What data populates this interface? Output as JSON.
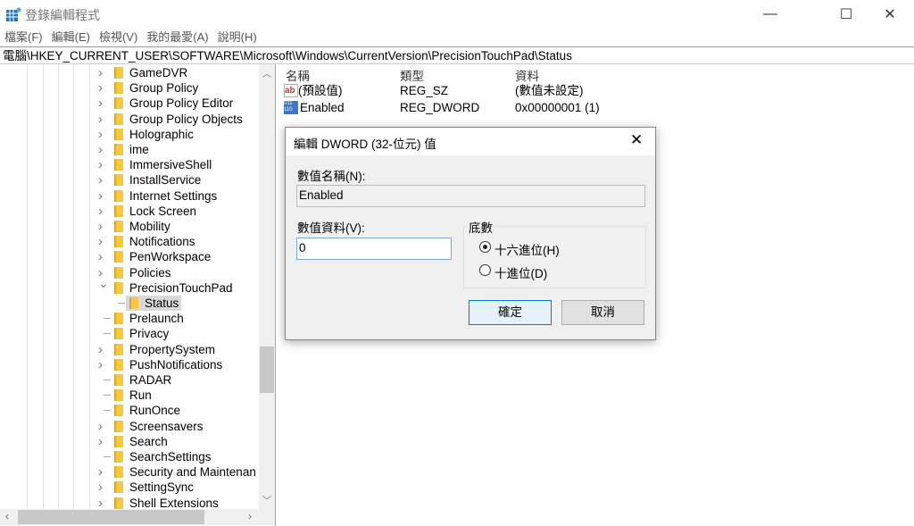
{
  "window": {
    "title": "登錄編輯程式",
    "minimize": "—",
    "maximize": "☐",
    "close": "✕"
  },
  "menu": [
    "檔案(F)",
    "編輯(E)",
    "檢視(V)",
    "我的最愛(A)",
    "說明(H)"
  ],
  "address": "電腦\\HKEY_CURRENT_USER\\SOFTWARE\\Microsoft\\Windows\\CurrentVersion\\PrecisionTouchPad\\Status",
  "tree": [
    {
      "label": "GameDVR",
      "exp": "collapsed"
    },
    {
      "label": "Group Policy",
      "exp": "collapsed"
    },
    {
      "label": "Group Policy Editor",
      "exp": "collapsed"
    },
    {
      "label": "Group Policy Objects",
      "exp": "collapsed"
    },
    {
      "label": "Holographic",
      "exp": "collapsed"
    },
    {
      "label": "ime",
      "exp": "collapsed"
    },
    {
      "label": "ImmersiveShell",
      "exp": "collapsed"
    },
    {
      "label": "InstallService",
      "exp": "collapsed"
    },
    {
      "label": "Internet Settings",
      "exp": "collapsed"
    },
    {
      "label": "Lock Screen",
      "exp": "collapsed"
    },
    {
      "label": "Mobility",
      "exp": "collapsed"
    },
    {
      "label": "Notifications",
      "exp": "collapsed"
    },
    {
      "label": "PenWorkspace",
      "exp": "collapsed"
    },
    {
      "label": "Policies",
      "exp": "collapsed"
    },
    {
      "label": "PrecisionTouchPad",
      "exp": "expanded"
    },
    {
      "label": "Status",
      "exp": "none",
      "child": true,
      "selected": true
    },
    {
      "label": "Prelaunch",
      "exp": "none"
    },
    {
      "label": "Privacy",
      "exp": "none"
    },
    {
      "label": "PropertySystem",
      "exp": "collapsed"
    },
    {
      "label": "PushNotifications",
      "exp": "collapsed"
    },
    {
      "label": "RADAR",
      "exp": "none"
    },
    {
      "label": "Run",
      "exp": "none"
    },
    {
      "label": "RunOnce",
      "exp": "none"
    },
    {
      "label": "Screensavers",
      "exp": "collapsed"
    },
    {
      "label": "Search",
      "exp": "collapsed"
    },
    {
      "label": "SearchSettings",
      "exp": "none"
    },
    {
      "label": "Security and Maintenan",
      "exp": "collapsed"
    },
    {
      "label": "SettingSync",
      "exp": "collapsed"
    },
    {
      "label": "Shell Extensions",
      "exp": "collapsed"
    }
  ],
  "list": {
    "headers": [
      "名稱",
      "類型",
      "資料"
    ],
    "rows": [
      {
        "icon": "string-value-icon",
        "name": "(預設值)",
        "type": "REG_SZ",
        "data": "(數值未設定)"
      },
      {
        "icon": "binary-value-icon",
        "name": "Enabled",
        "type": "REG_DWORD",
        "data": "0x00000001 (1)"
      }
    ]
  },
  "dialog": {
    "title": "編輯 DWORD (32-位元) 值",
    "close": "✕",
    "name_label": "數值名稱(N):",
    "name_value": "Enabled",
    "data_label": "數值資料(V):",
    "data_value": "0",
    "base_label": "底數",
    "hex": "十六進位(H)",
    "dec": "十進位(D)",
    "base_selected": "hex",
    "ok": "確定",
    "cancel": "取消"
  }
}
